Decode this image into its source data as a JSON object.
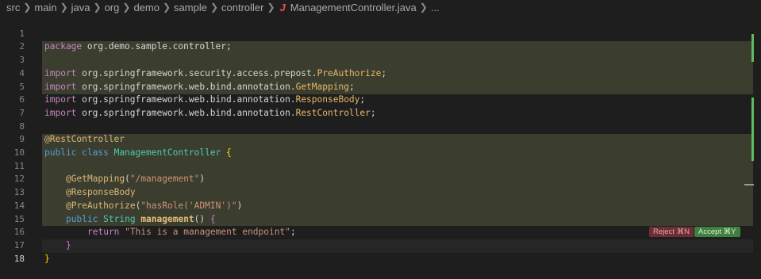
{
  "breadcrumb": {
    "parts": [
      "src",
      "main",
      "java",
      "org",
      "demo",
      "sample",
      "controller"
    ],
    "file_icon": "J",
    "file": "ManagementController.java",
    "more": "..."
  },
  "lines": {
    "n1": "1",
    "n2": "2",
    "n3": "3",
    "n4": "4",
    "n5": "5",
    "n6": "6",
    "n7": "7",
    "n8": "8",
    "n9": "9",
    "n10": "10",
    "n11": "11",
    "n12": "12",
    "n13": "13",
    "n14": "14",
    "n15": "15",
    "n16": "16",
    "n17": "17",
    "n18": "18"
  },
  "code": {
    "l1_kw": "package",
    "l1_rest": " org.demo.sample.controller;",
    "l3_kw": "import",
    "l3_pkg": " org.springframework.security.access.prepost.",
    "l3_cls": "PreAuthorize",
    "l4_kw": "import",
    "l4_pkg": " org.springframework.web.bind.annotation.",
    "l4_cls": "GetMapping",
    "l5_kw": "import",
    "l5_pkg": " org.springframework.web.bind.annotation.",
    "l5_cls": "ResponseBody",
    "l6_kw": "import",
    "l6_pkg": " org.springframework.web.bind.annotation.",
    "l6_cls": "RestController",
    "l8_anno": "@RestController",
    "l9_kw1": "public",
    "l9_kw2": " class ",
    "l9_type": "ManagementController",
    "l9_brace": " {",
    "l11_anno": "@GetMapping",
    "l11_p1": "(",
    "l11_str": "\"/management\"",
    "l11_p2": ")",
    "l12_anno": "@ResponseBody",
    "l13_anno": "@PreAuthorize",
    "l13_p1": "(",
    "l13_str": "\"hasRole('ADMIN')\"",
    "l13_p2": ")",
    "l14_kw1": "public",
    "l14_type": " String ",
    "l14_fn": "management",
    "l14_rest": "() ",
    "l14_brace": "{",
    "l15_kw": "return",
    "l15_str": " \"This is a management endpoint\"",
    "l15_semi": ";",
    "l16_brace": "}",
    "l17_brace": "}"
  },
  "actions": {
    "reject": "Reject ⌘N",
    "accept": "Accept ⌘Y"
  },
  "colors": {
    "added_bg": "#3b3e2e",
    "accept_bg": "#3f7f3f",
    "reject_bg": "#6b2e34",
    "diff_ruler": "#5fbb5f"
  }
}
